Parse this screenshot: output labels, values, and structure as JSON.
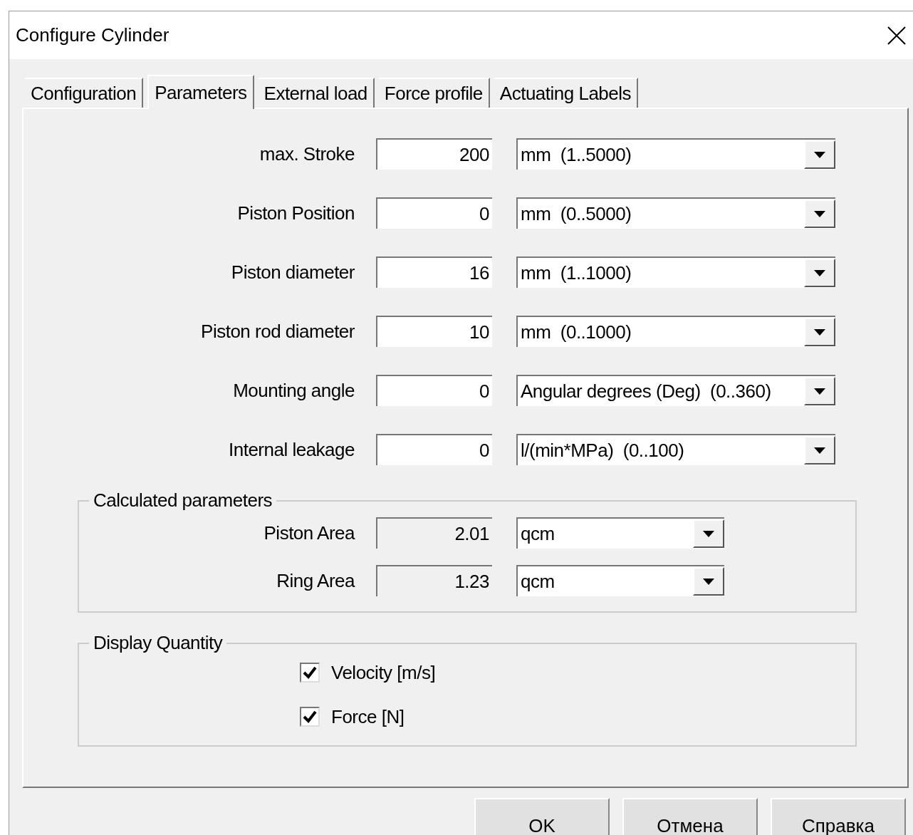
{
  "window": {
    "title": "Configure Cylinder"
  },
  "tabs": [
    {
      "label": "Configuration",
      "selected": false
    },
    {
      "label": "Parameters",
      "selected": true
    },
    {
      "label": "External load",
      "selected": false
    },
    {
      "label": "Force profile",
      "selected": false
    },
    {
      "label": "Actuating Labels",
      "selected": false
    }
  ],
  "parameters": [
    {
      "label": "max. Stroke",
      "value": "200",
      "unit": "mm  (1..5000)"
    },
    {
      "label": "Piston Position",
      "value": "0",
      "unit": "mm  (0..5000)"
    },
    {
      "label": "Piston diameter",
      "value": "16",
      "unit": "mm  (1..1000)"
    },
    {
      "label": "Piston rod diameter",
      "value": "10",
      "unit": "mm  (0..1000)"
    },
    {
      "label": "Mounting angle",
      "value": "0",
      "unit": "Angular degrees (Deg)  (0..360)"
    },
    {
      "label": "Internal leakage",
      "value": "0",
      "unit": "l/(min*MPa)  (0..100)"
    }
  ],
  "calculated": {
    "title": "Calculated parameters",
    "rows": [
      {
        "label": "Piston Area",
        "value": "2.01",
        "unit": "qcm",
        "disabled": true
      },
      {
        "label": "Ring Area",
        "value": "1.23",
        "unit": "qcm",
        "disabled": true
      }
    ]
  },
  "display_quantity": {
    "title": "Display Quantity",
    "options": [
      {
        "label": "Velocity [m/s]",
        "checked": true
      },
      {
        "label": "Force [N]",
        "checked": true
      }
    ]
  },
  "buttons": [
    "OK",
    "Отмена",
    "Справка"
  ]
}
